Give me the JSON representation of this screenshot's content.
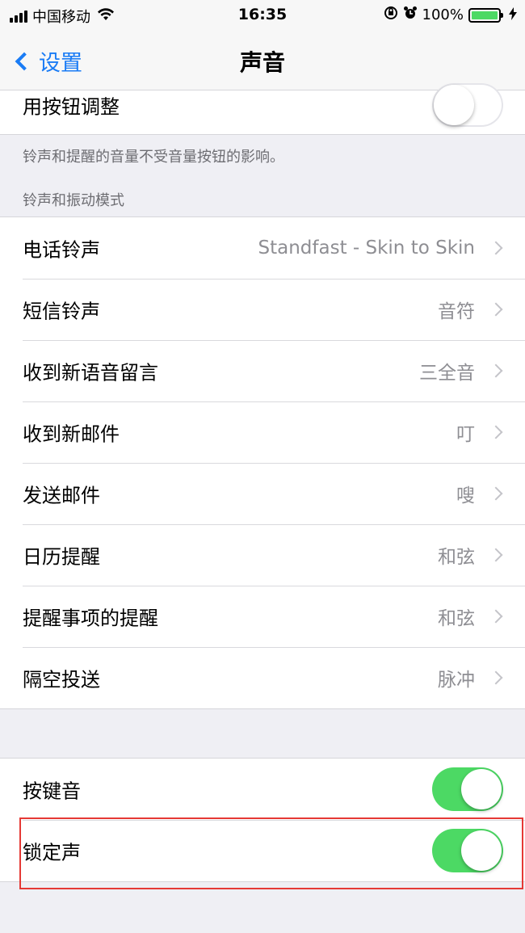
{
  "status_bar": {
    "carrier": "中国移动",
    "time": "16:35",
    "battery_percent": "100%",
    "battery_level": 1.0,
    "icons": [
      "signal-icon",
      "wifi-icon",
      "orientation-lock-icon",
      "alarm-icon",
      "battery-icon",
      "charging-icon"
    ]
  },
  "nav": {
    "back_label": "设置",
    "title": "声音"
  },
  "adjust_group": {
    "label": "用按钮调整",
    "toggle_on": false
  },
  "adjust_footer": "铃声和提醒的音量不受音量按钮的影响。",
  "ringtone_section_header": "铃声和振动模式",
  "sound_rows": [
    {
      "label": "电话铃声",
      "value": "Standfast - Skin to Skin"
    },
    {
      "label": "短信铃声",
      "value": "音符"
    },
    {
      "label": "收到新语音留言",
      "value": "三全音"
    },
    {
      "label": "收到新邮件",
      "value": "叮"
    },
    {
      "label": "发送邮件",
      "value": "嗖"
    },
    {
      "label": "日历提醒",
      "value": "和弦"
    },
    {
      "label": "提醒事项的提醒",
      "value": "和弦"
    },
    {
      "label": "隔空投送",
      "value": "脉冲"
    }
  ],
  "toggle_rows": [
    {
      "label": "按键音",
      "on": true
    },
    {
      "label": "锁定声",
      "on": true
    }
  ],
  "colors": {
    "accent": "#1a7cf5",
    "toggle_on": "#4cd964",
    "highlight": "#e53935",
    "background": "#efeff4"
  }
}
